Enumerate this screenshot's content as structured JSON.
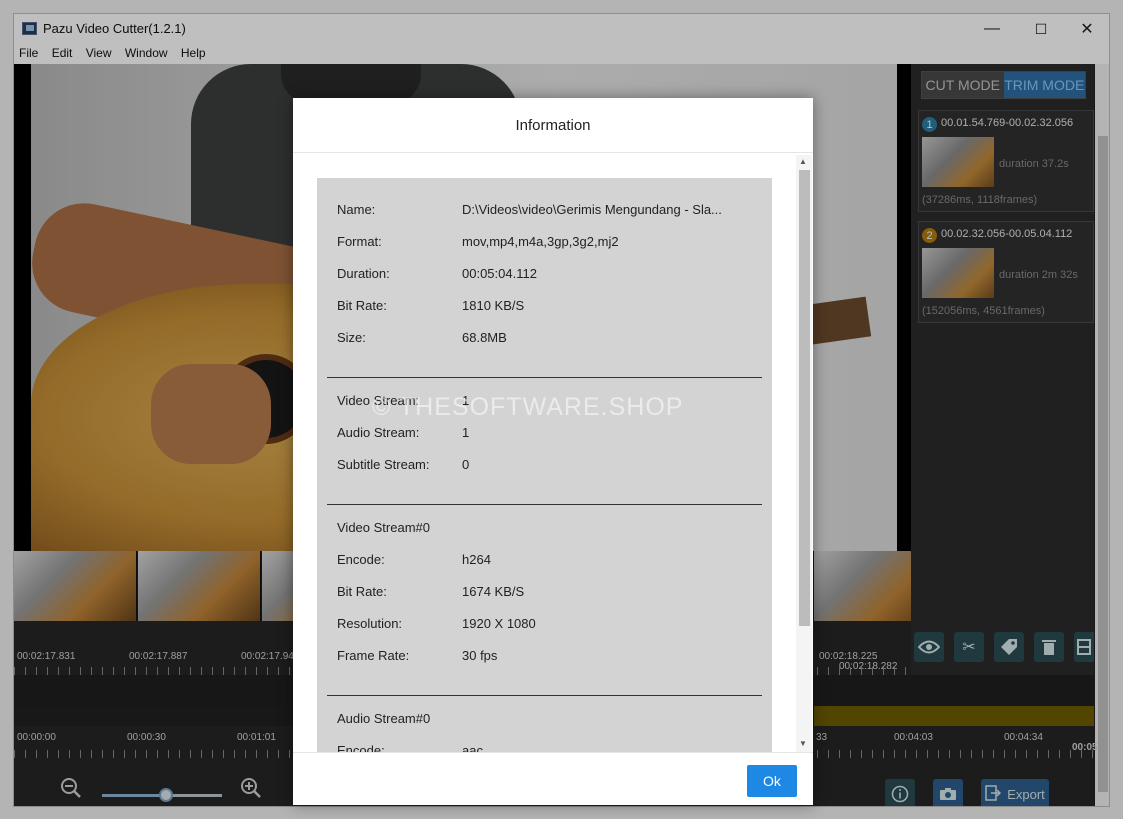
{
  "window": {
    "title": "Pazu Video Cutter(1.2.1)",
    "minimize": "—",
    "maximize": "☐",
    "close": "✕"
  },
  "menu": [
    "File",
    "Edit",
    "View",
    "Window",
    "Help"
  ],
  "video": {
    "watermark": "© THESOFTWARE.SHOP"
  },
  "modes": {
    "cut": "CUT MODE",
    "trim": "TRIM MODE",
    "active": "TRIM MODE"
  },
  "segments": [
    {
      "num": "1",
      "range": "00.01.54.769-00.02.32.056",
      "duration": "duration 37.2s",
      "frames": "(37286ms, 1118frames)",
      "color": "#2a7fa6"
    },
    {
      "num": "2",
      "range": "00.02.32.056-00.05.04.112",
      "duration": "duration 2m 32s",
      "frames": "(152056ms, 4561frames)",
      "color": "#b07d10"
    }
  ],
  "timeline": {
    "top_labels": [
      "00:02:17.831",
      "00:02:17.887",
      "00:02:17.94",
      "00:02:18.225",
      "00:02:18.282"
    ],
    "bottom_labels": [
      "00:00:00",
      "00:00:30",
      "00:01:01",
      "33",
      "00:04:03",
      "00:04:34",
      "00:05"
    ]
  },
  "bottom_icons": [
    "zoom-out-icon",
    "zoom-in-icon",
    "info-icon",
    "camera-icon",
    "export-icon"
  ],
  "export_label": "Export",
  "zoom_level": 0.53,
  "tools": [
    "eye-icon",
    "scissors-icon",
    "tag-icon",
    "trash-icon",
    "split-icon"
  ],
  "dialog": {
    "title": "Information",
    "ok": "Ok",
    "general": [
      {
        "label": "Name:",
        "value": "D:\\Videos\\video\\Gerimis Mengundang - Sla..."
      },
      {
        "label": "Format:",
        "value": "mov,mp4,m4a,3gp,3g2,mj2"
      },
      {
        "label": "Duration:",
        "value": "00:05:04.112"
      },
      {
        "label": "Bit Rate:",
        "value": "1810 KB/S"
      },
      {
        "label": "Size:",
        "value": "68.8MB"
      }
    ],
    "streams": [
      {
        "label": "Video Stream:",
        "value": "1"
      },
      {
        "label": "Audio Stream:",
        "value": "1"
      },
      {
        "label": "Subtitle Stream:",
        "value": "0"
      }
    ],
    "video_stream_title": "Video Stream#0",
    "video_stream": [
      {
        "label": "Encode:",
        "value": "h264"
      },
      {
        "label": "Bit Rate:",
        "value": "1674 KB/S"
      },
      {
        "label": "Resolution:",
        "value": "1920 X 1080"
      },
      {
        "label": "Frame Rate:",
        "value": "30 fps"
      }
    ],
    "audio_stream_title": "Audio Stream#0",
    "audio_stream": [
      {
        "label": "Encode:",
        "value": "aac"
      }
    ]
  },
  "colors": {
    "accent": "#1e88e5",
    "tool_bg": "#2b4d55",
    "trim_active": "#2f6fa7"
  }
}
